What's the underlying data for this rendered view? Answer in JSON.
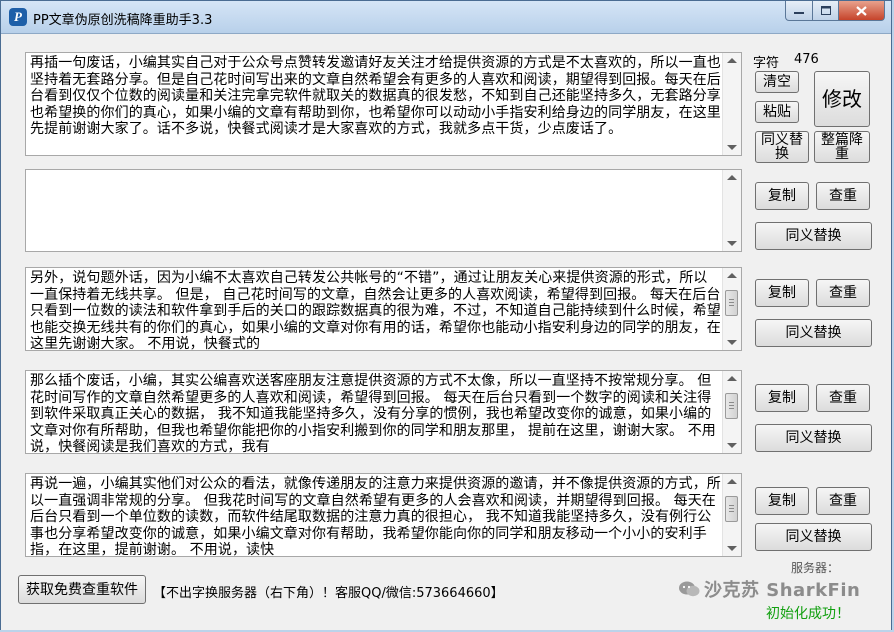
{
  "window": {
    "title": "PP文章伪原创洗稿降重助手3.3",
    "icon_letter": "P"
  },
  "editor": {
    "char_count_label": "字符",
    "char_count": "476",
    "source_text": "再插一句废话，小编其实自己对于公众号点赞转发邀请好友关注才给提供资源的方式是不太喜欢的，所以一直也坚持着无套路分享。但是自己花时间写出来的文章自然希望会有更多的人喜欢和阅读，期望得到回报。每天在后台看到仅仅个位数的阅读量和关注完拿完软件就取关的数据真的很发愁，不知到自己还能坚持多久，无套路分享也希望换的你们的真心，如果小编的文章有帮助到你，也希望你可以动动小手指安利给身边的同学朋友，在这里先提前谢谢大家了。话不多说，快餐式阅读才是大家喜欢的方式，我就多点干货，少点废话了。",
    "clear_label": "清空",
    "paste_label": "粘贴",
    "modify_label": "修改",
    "synonym_label": "同义替换",
    "whole_label": "整篇降重"
  },
  "results": [
    {
      "text": "",
      "copy_label": "复制",
      "check_label": "查重",
      "synonym_label": "同义替换"
    },
    {
      "text": "另外，说句题外话，因为小编不太喜欢自己转发公共帐号的“不错”，通过让朋友关心来提供资源的形式，所以一直保持着无线共享。 但是， 自己花时间写的文章，自然会让更多的人喜欢阅读，希望得到回报。 每天在后台只看到一位数的读法和软件拿到手后的关口的跟踪数据真的很为难，不过，不知道自己能持续到什么时候，希望也能交换无线共有的你们的真心，如果小编的文章对你有用的话，希望你也能动小指安利身边的同学的朋友，在这里先谢谢大家。 不用说，快餐式的",
      "copy_label": "复制",
      "check_label": "查重",
      "synonym_label": "同义替换"
    },
    {
      "text": "那么插个废话，小编，其实公编喜欢送客座朋友注意提供资源的方式不太像，所以一直坚持不按常规分享。 但花时间写作的文章自然希望更多的人喜欢和阅读，希望得到回报。 每天在后台只看到一个数字的阅读和关注得到软件采取真正关心的数据， 我不知道我能坚持多久，没有分享的惯例，我也希望改变你的诚意，如果小编的文章对你有所帮助，但我也希望你能把你的小指安利搬到你的同学和朋友那里， 提前在这里，谢谢大家。 不用说，快餐阅读是我们喜欢的方式，我有",
      "copy_label": "复制",
      "check_label": "查重",
      "synonym_label": "同义替换"
    },
    {
      "text": "再说一遍，小编其实他们对公众的看法，就像传递朋友的注意力来提供资源的邀请，并不像提供资源的方式，所以一直强调非常规的分享。 但我花时间写的文章自然希望有更多的人会喜欢和阅读，并期望得到回报。 每天在后台只看到一个单位数的读数，而软件结尾取数据的注意力真的很担心， 我不知道我能坚持多久，没有例行公事也分享希望改变你的诚意，如果小编文章对你有帮助，我希望你能向你的同学和朋友移动一个小小的安利手指，在这里，提前谢谢。 不用说，读快",
      "copy_label": "复制",
      "check_label": "查重",
      "synonym_label": "同义替换"
    }
  ],
  "footer": {
    "get_software_label": "获取免费查重软件",
    "notice": "【不出字换服务器（右下角）！客服QQ/微信:573664660】",
    "server_label": "服务器：",
    "watermark": "沙克苏 SharkFin",
    "status": "初始化成功！"
  }
}
